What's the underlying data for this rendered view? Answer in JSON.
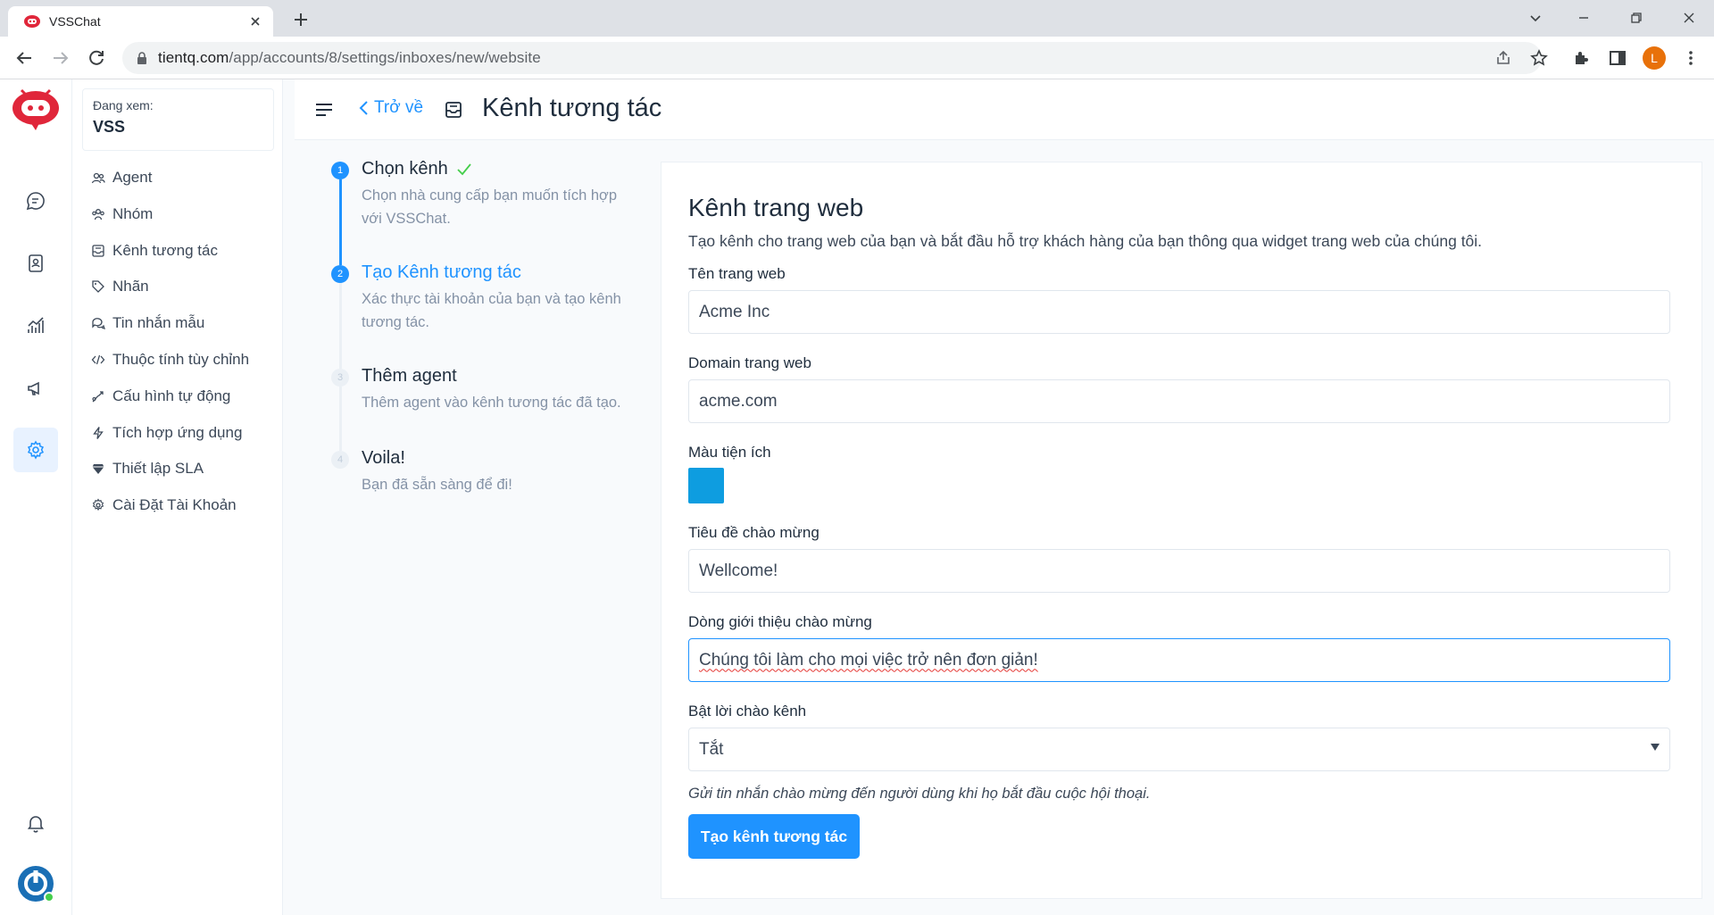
{
  "browser": {
    "tab_title": "VSSChat",
    "url_host": "tientq.com",
    "url_path": "/app/accounts/8/settings/inboxes/new/website",
    "profile_initial": "L"
  },
  "account_switcher": {
    "label": "Đang xem:",
    "account": "VSS"
  },
  "settings_nav": [
    {
      "label": "Agent",
      "icon": "people-icon"
    },
    {
      "label": "Nhóm",
      "icon": "people-team-icon"
    },
    {
      "label": "Kênh tương tác",
      "icon": "mail-inbox-icon"
    },
    {
      "label": "Nhãn",
      "icon": "tag-icon"
    },
    {
      "label": "Tin nhắn mẫu",
      "icon": "chat-multiple-icon"
    },
    {
      "label": "Thuộc tính tùy chỉnh",
      "icon": "code-icon"
    },
    {
      "label": "Cấu hình tự động",
      "icon": "automation-icon"
    },
    {
      "label": "Tích hợp ứng dụng",
      "icon": "flash-icon"
    },
    {
      "label": "Thiết lập SLA",
      "icon": "sla-icon"
    },
    {
      "label": "Cài Đặt Tài Khoản",
      "icon": "gear-icon"
    }
  ],
  "header": {
    "back_label": "Trở về",
    "title": "Kênh tương tác"
  },
  "wizard": {
    "steps": [
      {
        "number": "1",
        "title": "Chọn kênh",
        "description": "Chọn nhà cung cấp bạn muốn tích hợp với VSSChat.",
        "state": "done"
      },
      {
        "number": "2",
        "title": "Tạo Kênh tương tác",
        "description": "Xác thực tài khoản của bạn và tạo kênh tương tác.",
        "state": "active"
      },
      {
        "number": "3",
        "title": "Thêm agent",
        "description": "Thêm agent vào kênh tương tác đã tạo.",
        "state": "pending"
      },
      {
        "number": "4",
        "title": "Voila!",
        "description": "Bạn đã sẵn sàng để đi!",
        "state": "pending"
      }
    ]
  },
  "form": {
    "title": "Kênh trang web",
    "subtitle": "Tạo kênh cho trang web của bạn và bắt đầu hỗ trợ khách hàng của bạn thông qua widget trang web của chúng tôi.",
    "website_name": {
      "label": "Tên trang web",
      "value": "Acme Inc"
    },
    "website_domain": {
      "label": "Domain trang web",
      "value": "acme.com"
    },
    "widget_color": {
      "label": "Màu tiện ích",
      "value": "#0E9DE0"
    },
    "welcome_heading": {
      "label": "Tiêu đề chào mừng",
      "value": "Wellcome!"
    },
    "welcome_tagline": {
      "label": "Dòng giới thiệu chào mừng",
      "value": "Chúng tôi làm cho mọi việc trở nên đơn giản!"
    },
    "greeting": {
      "label": "Bật lời chào kênh",
      "value": "Tắt",
      "help": "Gửi tin nhắn chào mừng đến người dùng khi họ bắt đầu cuộc hội thoại."
    },
    "submit_label": "Tạo kênh tương tác"
  },
  "colors": {
    "brand": "#1F93FF",
    "logo": "#E0263A",
    "widget_swatch": "#0E9DE0"
  }
}
